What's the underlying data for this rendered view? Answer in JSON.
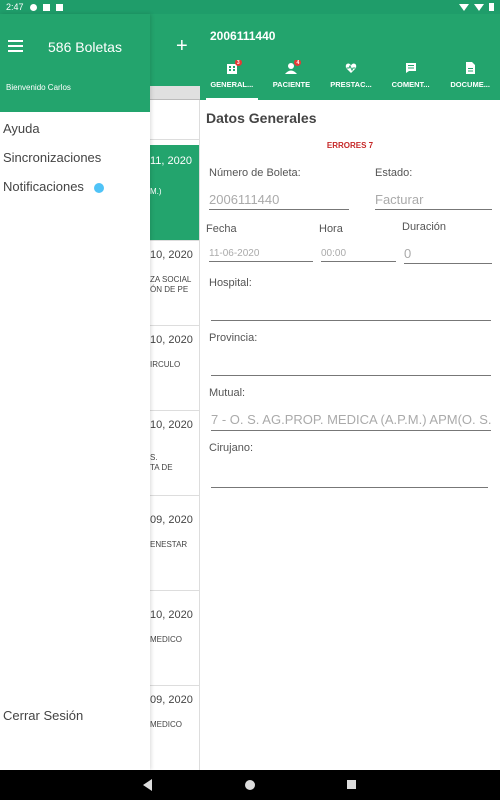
{
  "status_bar": {
    "time": "2:47"
  },
  "drawer": {
    "title": "586 Boletas",
    "welcome": "Bienvenido Carlos",
    "menu": [
      "Ayuda",
      "Sincronizaciones",
      "Notificaciones"
    ],
    "logout": "Cerrar Sesión",
    "accent_color": "#23a46d",
    "notification_dot_color": "#4fc3f7"
  },
  "header": {
    "title": "2006111440",
    "tabs": [
      {
        "label": "GENERAL...",
        "icon": "building-icon",
        "badge": "3"
      },
      {
        "label": "PACIENTE",
        "icon": "person-icon",
        "badge": "4"
      },
      {
        "label": "PRESTAC...",
        "icon": "heartbeat-icon",
        "badge": ""
      },
      {
        "label": "COMENT...",
        "icon": "comment-icon",
        "badge": ""
      },
      {
        "label": "DOCUME...",
        "icon": "document-icon",
        "badge": ""
      }
    ]
  },
  "list": {
    "items": [
      {
        "date": "11, 2020",
        "sub": [
          "M.)"
        ]
      },
      {
        "date": "10, 2020",
        "sub": [
          "ZA SOCIAL",
          "ÓN DE PE"
        ]
      },
      {
        "date": "10, 2020",
        "sub": [
          "IRCULO"
        ]
      },
      {
        "date": "10, 2020",
        "sub": [
          "",
          "S.",
          "TA DE"
        ]
      },
      {
        "date": "09, 2020",
        "sub": [
          "ENESTAR"
        ]
      },
      {
        "date": "10, 2020",
        "sub": [
          "MEDICO"
        ]
      },
      {
        "date": "09, 2020",
        "sub": [
          "MEDICO"
        ]
      }
    ]
  },
  "form": {
    "section_title": "Datos Generales",
    "errors": "ERRORES 7",
    "numero_label": "Número de Boleta:",
    "numero_value": "2006111440",
    "estado_label": "Estado:",
    "estado_value": "Facturar",
    "fecha_label": "Fecha",
    "fecha_value": "11-06-2020",
    "hora_label": "Hora",
    "hora_value": "00:00",
    "duracion_label": "Duración",
    "duracion_value": "0",
    "hospital_label": "Hospital:",
    "hospital_value": "",
    "provincia_label": "Provincia:",
    "provincia_value": "",
    "mutual_label": "Mutual:",
    "mutual_value": "7 - O. S. AG.PROP. MEDICA (A.P.M.) APM(O. S.",
    "cirujano_label": "Cirujano:",
    "cirujano_value": ""
  }
}
